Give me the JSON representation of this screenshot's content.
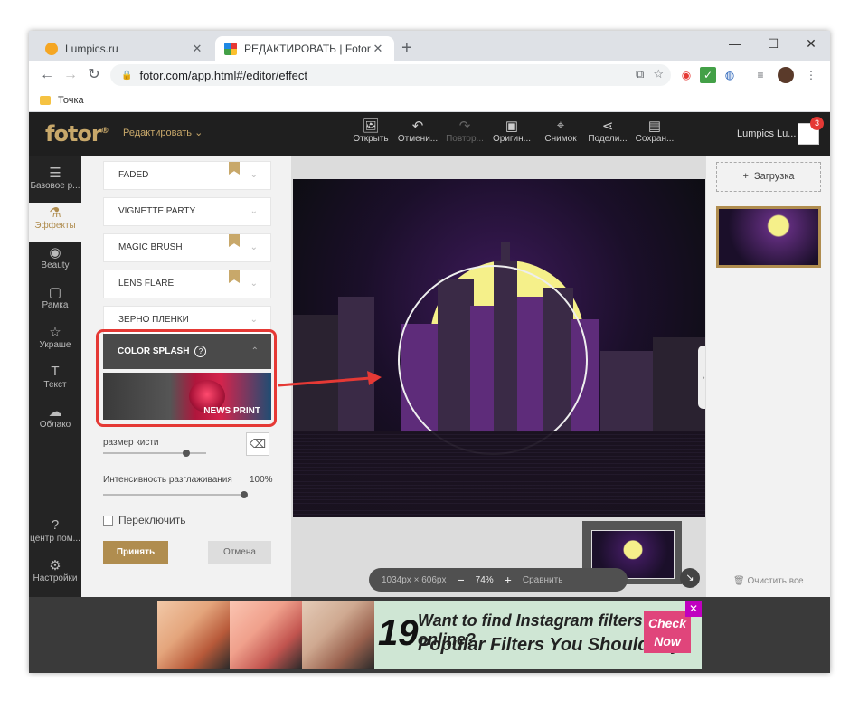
{
  "browser": {
    "tabs": [
      {
        "title": "Lumpics.ru",
        "favicon_color": "#f5a623"
      },
      {
        "title": "РЕДАКТИРОВАТЬ | Fotor",
        "favicon_color": "#e53935"
      }
    ],
    "new_tab": "+",
    "controls": {
      "minimize": "—",
      "maximize": "☐",
      "close": "✕"
    },
    "url": "fotor.com/app.html#/editor/effect",
    "bookmark": "Точка"
  },
  "app": {
    "logo": "fotor",
    "logo_mark": "®",
    "menu_label": "Редактировать",
    "toolbar": [
      {
        "label": "Открыть",
        "icon": "open-icon"
      },
      {
        "label": "Отмени...",
        "icon": "undo-icon"
      },
      {
        "label": "Повтор...",
        "icon": "redo-icon",
        "disabled": true
      },
      {
        "label": "Оригин...",
        "icon": "original-icon"
      },
      {
        "label": "Снимок",
        "icon": "snapshot-icon"
      },
      {
        "label": "Подели...",
        "icon": "share-icon"
      },
      {
        "label": "Сохран...",
        "icon": "save-icon"
      }
    ],
    "user_name": "Lumpics Lu...",
    "notification_count": "3"
  },
  "rail": [
    {
      "label": "Базовое р...",
      "icon": "sliders-icon"
    },
    {
      "label": "Эффекты",
      "icon": "flask-icon",
      "active": true
    },
    {
      "label": "Beauty",
      "icon": "eye-icon"
    },
    {
      "label": "Рамка",
      "icon": "frame-icon"
    },
    {
      "label": "Украше",
      "icon": "star-icon"
    },
    {
      "label": "Текст",
      "icon": "text-icon"
    },
    {
      "label": "Облако",
      "icon": "cloud-icon"
    },
    {
      "label": "центр пом...",
      "icon": "help-icon"
    },
    {
      "label": "Настройки",
      "icon": "gear-icon"
    }
  ],
  "effects": {
    "items": [
      {
        "label": "FADED",
        "premium": true
      },
      {
        "label": "VIGNETTE PARTY",
        "premium": false
      },
      {
        "label": "MAGIC BRUSH",
        "premium": true
      },
      {
        "label": "LENS FLARE",
        "premium": true
      },
      {
        "label": "ЗЕРНО ПЛЕНКИ",
        "premium": false
      }
    ],
    "open_item": "COLOR SPLASH",
    "preview_label": "NEWS PRINT",
    "brush_size_label": "размер кисти",
    "brush_size_value": 0.8,
    "smoothing_label": "Интенсивность разглаживания",
    "smoothing_value": "100%",
    "toggle_label": "Переключить",
    "accept": "Принять",
    "cancel": "Отмена"
  },
  "canvas": {
    "dimensions": "1034px × 606px",
    "zoom": "74%",
    "compare": "Сравнить"
  },
  "right_panel": {
    "upload": "Загрузка",
    "clear_all": "Очистить все"
  },
  "ad": {
    "number": "19",
    "line1": "Want to find Instagram filters online?",
    "line2": "Popular Filters You Should Try",
    "cta_line1": "Check",
    "cta_line2": "Now"
  },
  "colors": {
    "accent": "#b08d4f",
    "highlight": "#e53935"
  }
}
